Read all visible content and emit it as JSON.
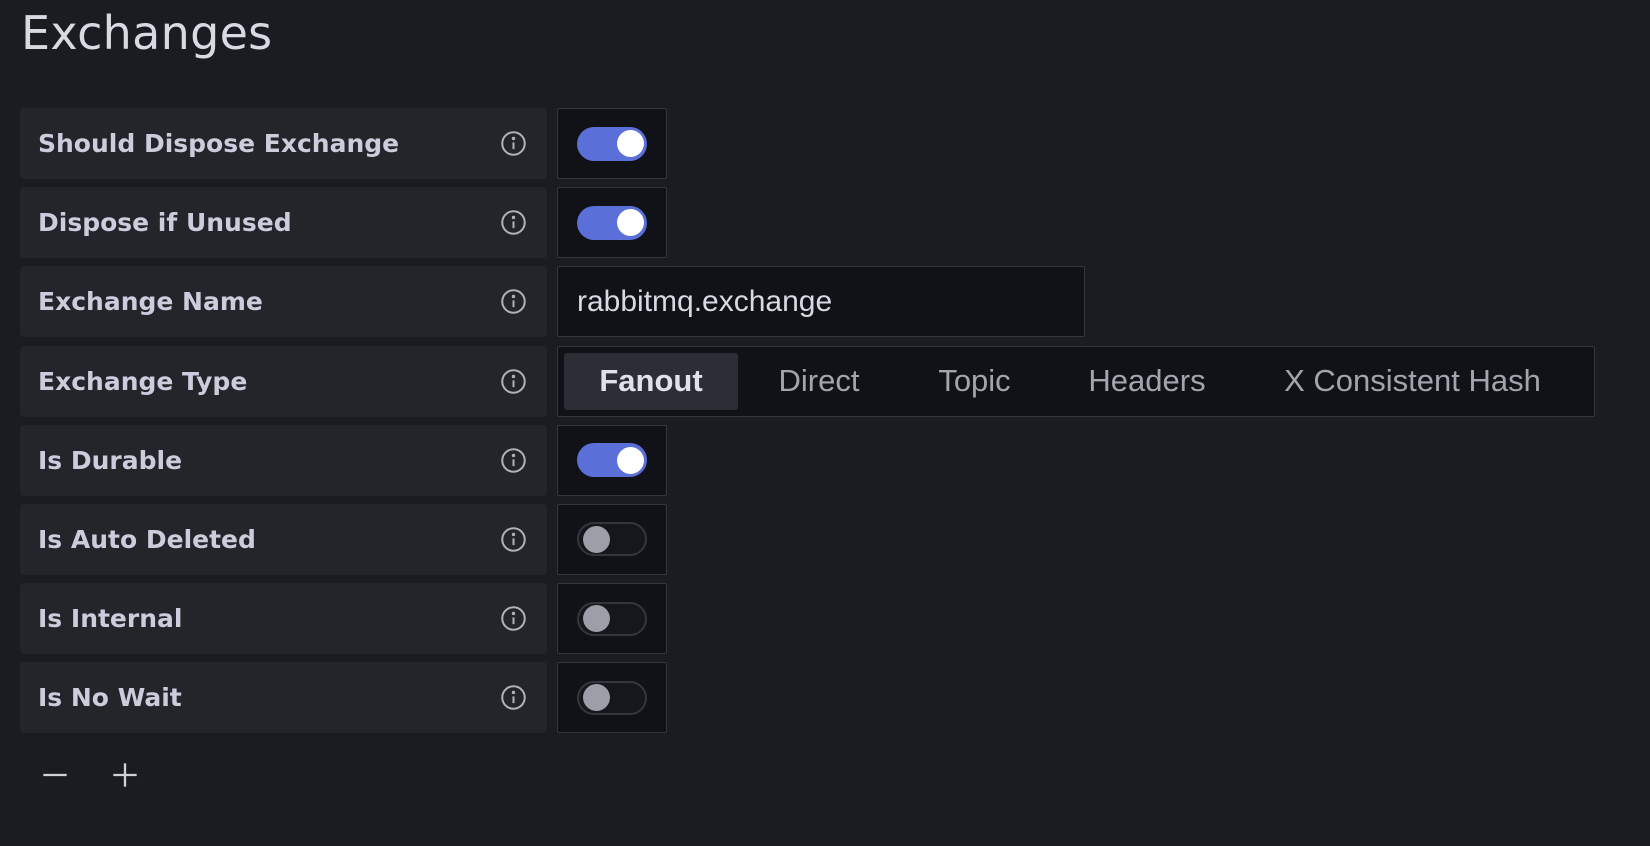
{
  "page": {
    "title": "Exchanges"
  },
  "rows": [
    {
      "label": "Should Dispose Exchange",
      "type": "switch",
      "value": true
    },
    {
      "label": "Dispose if Unused",
      "type": "switch",
      "value": true
    },
    {
      "label": "Exchange Name",
      "type": "input",
      "value": "rabbitmq.exchange"
    },
    {
      "label": "Exchange Type",
      "type": "radio",
      "options": [
        "Fanout",
        "Direct",
        "Topic",
        "Headers",
        "X Consistent Hash"
      ],
      "selected": "Fanout"
    },
    {
      "label": "Is Durable",
      "type": "switch",
      "value": true
    },
    {
      "label": "Is Auto Deleted",
      "type": "switch",
      "value": false
    },
    {
      "label": "Is Internal",
      "type": "switch",
      "value": false
    },
    {
      "label": "Is No Wait",
      "type": "switch",
      "value": false
    }
  ],
  "icons": {
    "info": "info-circle-icon",
    "remove": "minus-icon",
    "add": "plus-icon"
  },
  "colors": {
    "background": "#1b1c21",
    "label_background": "#23252b",
    "control_background": "#111217",
    "switch_on": "#5a6fd8",
    "selected_option_background": "#2c2e35"
  }
}
